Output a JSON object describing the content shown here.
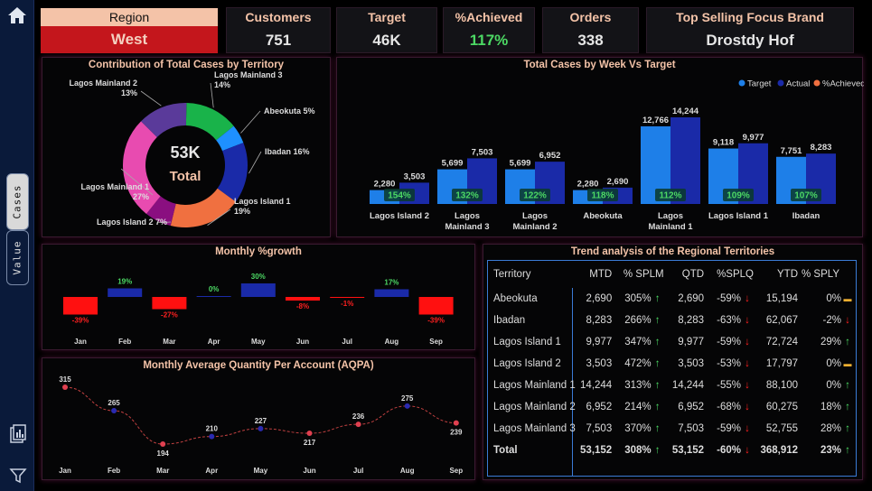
{
  "colors": {
    "accent_peach": "#f4c3a8",
    "region_red": "#c4161c",
    "green_pct": "#4cd964",
    "target_blue": "#1e7fe8",
    "actual_navy": "#1a2aa8",
    "achieved_orange": "#f07040",
    "negative_red": "#ff2020"
  },
  "sidebar": {
    "tab_cases": "Cases",
    "tab_value": "Value"
  },
  "region": {
    "label": "Region",
    "value": "West"
  },
  "kpis": {
    "customers": {
      "label": "Customers",
      "value": "751"
    },
    "target": {
      "label": "Target",
      "value": "46K"
    },
    "achieved": {
      "label": "%Achieved",
      "value": "117%"
    },
    "orders": {
      "label": "Orders",
      "value": "338"
    },
    "brand": {
      "label": "Top Selling Focus Brand",
      "value": "Drostdy Hof"
    }
  },
  "donut": {
    "title": "Contribution of Total Cases by Territory",
    "center_value": "53K",
    "center_label": "Total"
  },
  "weekly": {
    "title": "Total Cases by Week Vs Target",
    "legend": [
      "Target",
      "Actual",
      "%Achieved"
    ]
  },
  "growth": {
    "title": "Monthly %growth"
  },
  "aqpa": {
    "title": "Monthly Average Quantity Per Account (AQPA)"
  },
  "trend": {
    "title": "Trend analysis of the Regional Territories",
    "headers": [
      "Territory",
      "MTD",
      "% SPLM",
      "QTD",
      "%SPLQ",
      "YTD",
      "% SPLY"
    ],
    "rows": [
      [
        "Abeokuta",
        "2,690",
        "305%",
        "up",
        "2,690",
        "-59%",
        "down",
        "15,194",
        "0%",
        "flat"
      ],
      [
        "Ibadan",
        "8,283",
        "266%",
        "up",
        "8,283",
        "-63%",
        "down",
        "62,067",
        "-2%",
        "down"
      ],
      [
        "Lagos Island 1",
        "9,977",
        "347%",
        "up",
        "9,977",
        "-59%",
        "down",
        "72,724",
        "29%",
        "up"
      ],
      [
        "Lagos Island 2",
        "3,503",
        "472%",
        "up",
        "3,503",
        "-53%",
        "down",
        "17,797",
        "0%",
        "flat"
      ],
      [
        "Lagos Mainland 1",
        "14,244",
        "313%",
        "up",
        "14,244",
        "-55%",
        "down",
        "88,100",
        "0%",
        "up"
      ],
      [
        "Lagos Mainland 2",
        "6,952",
        "214%",
        "up",
        "6,952",
        "-68%",
        "down",
        "60,275",
        "18%",
        "up"
      ],
      [
        "Lagos Mainland 3",
        "7,503",
        "370%",
        "up",
        "7,503",
        "-59%",
        "down",
        "52,755",
        "28%",
        "up"
      ]
    ],
    "total": [
      "Total",
      "53,152",
      "308%",
      "up",
      "53,152",
      "-60%",
      "down",
      "368,912",
      "23%",
      "up"
    ]
  },
  "chart_data": [
    {
      "type": "pie",
      "title": "Contribution of Total Cases by Territory",
      "categories": [
        "Lagos Mainland 3",
        "Abeokuta",
        "Ibadan",
        "Lagos Island 1",
        "Lagos Island 2",
        "Lagos Mainland 1",
        "Lagos Mainland 2"
      ],
      "labels": [
        "Lagos Mainland 3\n14%",
        "Abeokuta 5%",
        "Ibadan 16%",
        "Lagos Island 1\n19%",
        "Lagos Island 2 7%",
        "Lagos Mainland 1\n27%",
        "Lagos Mainland 2\n13%"
      ],
      "values": [
        14,
        5,
        16,
        19,
        7,
        27,
        13
      ],
      "colors": [
        "#19b34a",
        "#1e90ff",
        "#1a2aa8",
        "#f07040",
        "#8a0f80",
        "#e84bb0",
        "#5a3a9a"
      ],
      "center": "53K"
    },
    {
      "type": "bar",
      "title": "Total Cases by Week Vs Target",
      "categories": [
        "Lagos Island 2",
        "Lagos Mainland 3",
        "Lagos Mainland 2",
        "Abeokuta",
        "Lagos Mainland 1",
        "Lagos Island 1",
        "Ibadan"
      ],
      "category_labels": [
        "Lagos Island 2",
        "Lagos\nMainland 3",
        "Lagos\nMainland 2",
        "Abeokuta",
        "Lagos\nMainland 1",
        "Lagos Island 1",
        "Ibadan"
      ],
      "series": [
        {
          "name": "Target",
          "values": [
            2280,
            5699,
            5699,
            2280,
            12766,
            9118,
            7751
          ],
          "labels": [
            "2,280",
            "5,699",
            "5,699",
            "2,280",
            "12,766",
            "9,118",
            "7,751"
          ]
        },
        {
          "name": "Actual",
          "values": [
            3503,
            7503,
            6952,
            2690,
            14244,
            9977,
            8283
          ],
          "labels": [
            "3,503",
            "7,503",
            "6,952",
            "2,690",
            "14,244",
            "9,977",
            "8,283"
          ]
        },
        {
          "name": "%Achieved",
          "values": [
            154,
            132,
            122,
            118,
            112,
            109,
            107
          ],
          "labels": [
            "154%",
            "132%",
            "122%",
            "118%",
            "112%",
            "109%",
            "107%"
          ]
        }
      ],
      "legend": "top-right"
    },
    {
      "type": "bar",
      "title": "Monthly %growth",
      "categories": [
        "Jan",
        "Feb",
        "Mar",
        "Apr",
        "May",
        "Jun",
        "Jul",
        "Aug",
        "Sep"
      ],
      "values": [
        -39,
        19,
        -27,
        0,
        30,
        -8,
        -1,
        17,
        -39
      ],
      "labels": [
        "-39%",
        "19%",
        "-27%",
        "0%",
        "30%",
        "-8%",
        "-1%",
        "17%",
        "-39%"
      ]
    },
    {
      "type": "line",
      "title": "Monthly Average Quantity Per Account (AQPA)",
      "categories": [
        "Jan",
        "Feb",
        "Mar",
        "Apr",
        "May",
        "Jun",
        "Jul",
        "Aug",
        "Sep"
      ],
      "values": [
        315,
        265,
        194,
        210,
        227,
        217,
        236,
        275,
        239
      ]
    }
  ]
}
